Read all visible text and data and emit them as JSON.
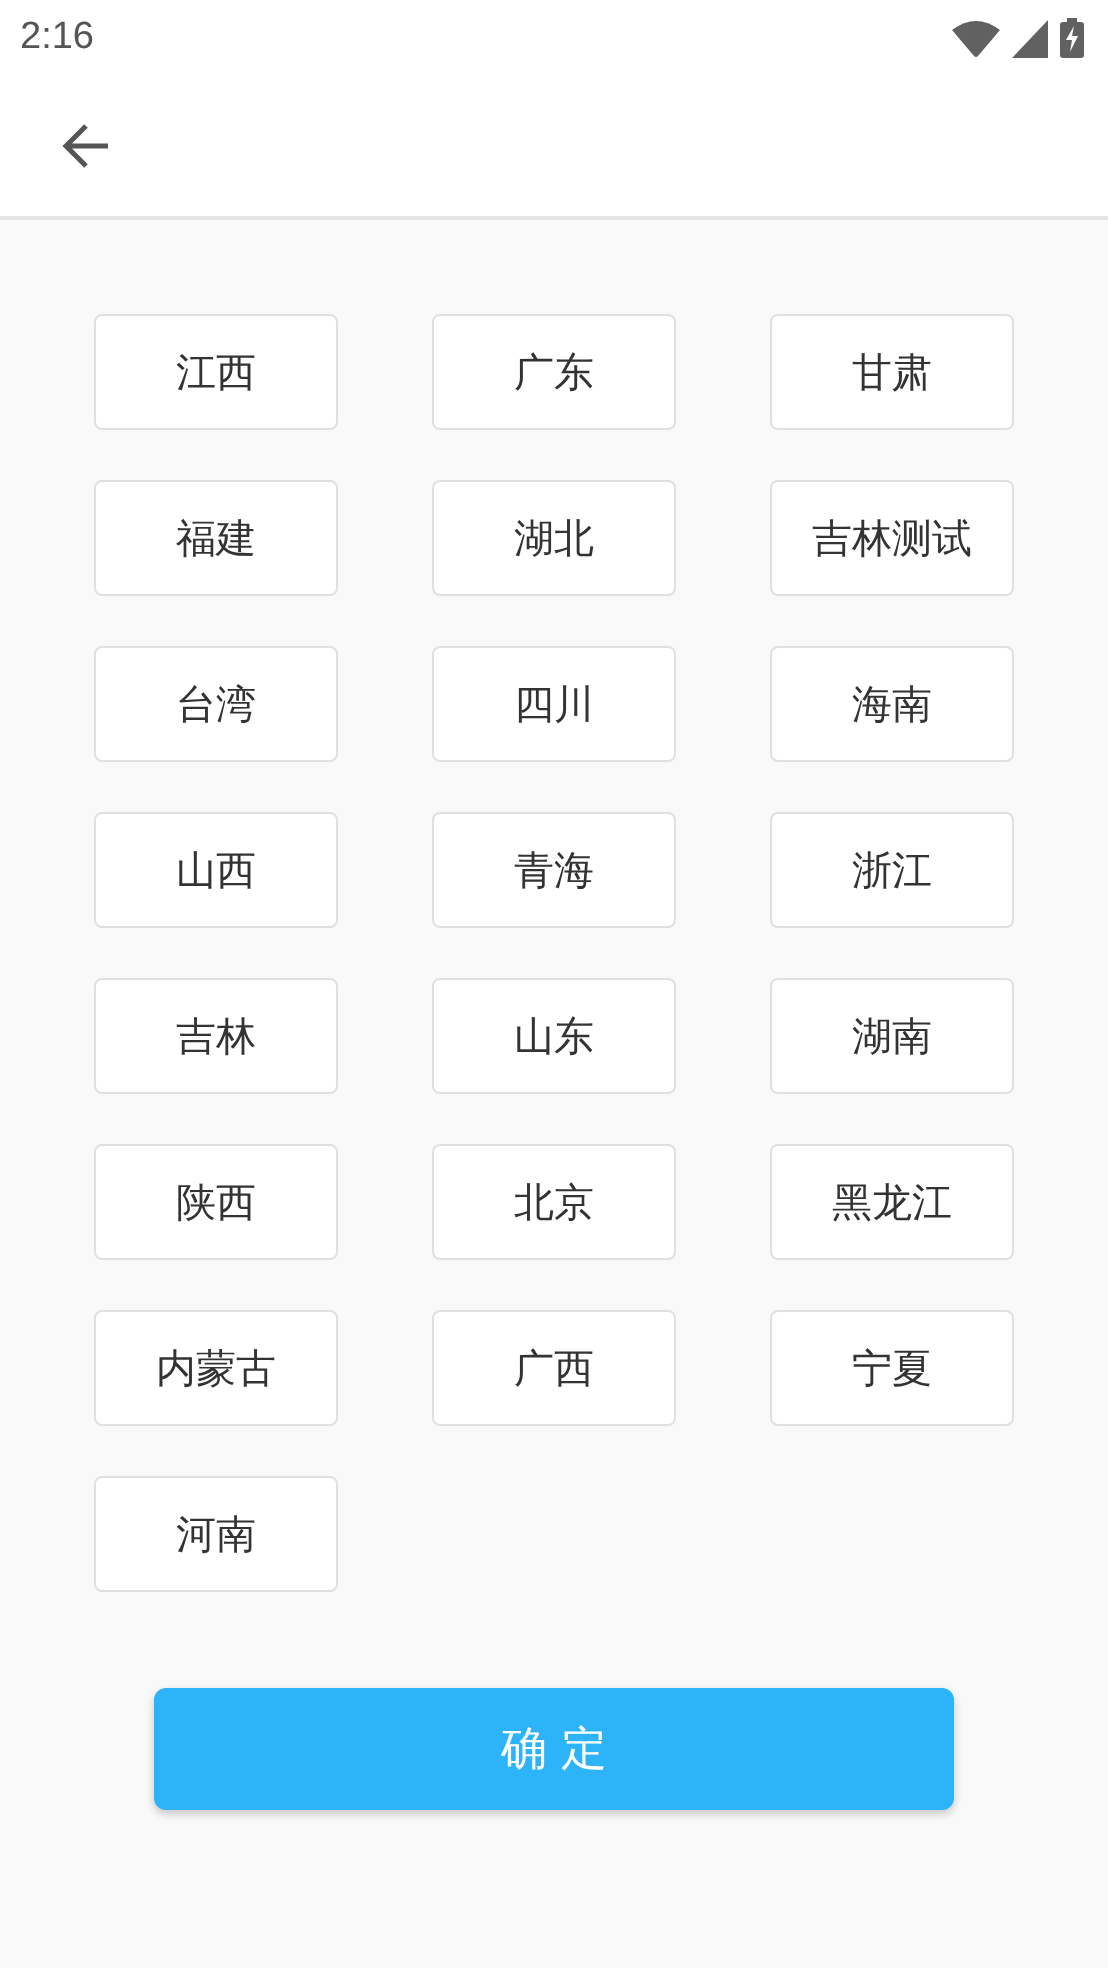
{
  "status_bar": {
    "time": "2:16"
  },
  "provinces": [
    {
      "label": "江西"
    },
    {
      "label": "广东"
    },
    {
      "label": "甘肃"
    },
    {
      "label": "福建"
    },
    {
      "label": "湖北"
    },
    {
      "label": "吉林测试"
    },
    {
      "label": "台湾"
    },
    {
      "label": "四川"
    },
    {
      "label": "海南"
    },
    {
      "label": "山西"
    },
    {
      "label": "青海"
    },
    {
      "label": "浙江"
    },
    {
      "label": "吉林"
    },
    {
      "label": "山东"
    },
    {
      "label": "湖南"
    },
    {
      "label": "陕西"
    },
    {
      "label": "北京"
    },
    {
      "label": "黑龙江"
    },
    {
      "label": "内蒙古"
    },
    {
      "label": "广西"
    },
    {
      "label": "宁夏"
    },
    {
      "label": "河南"
    }
  ],
  "confirm_button": "确 定"
}
